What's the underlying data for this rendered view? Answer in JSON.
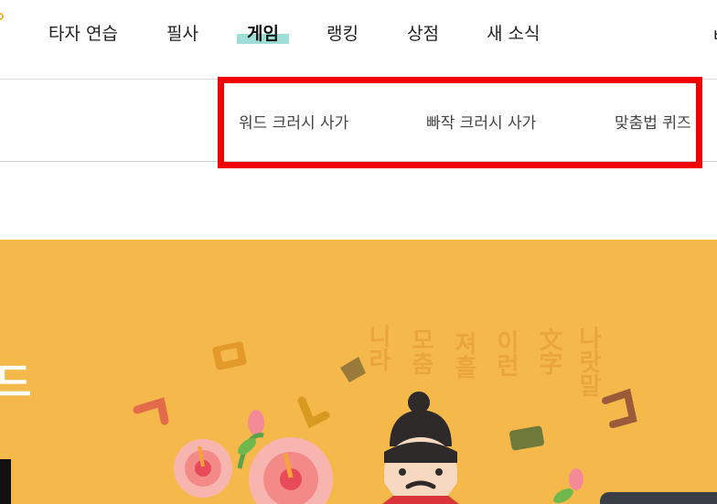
{
  "nav": {
    "items": [
      "타자 연습",
      "필사",
      "게임",
      "랭킹",
      "상점",
      "새 소식"
    ],
    "active_index": 2,
    "edge_glyph": "ㅂ"
  },
  "submenu": {
    "items": [
      "워드 크러시 사가",
      "빠작 크러시 사가",
      "맞춤법 퀴즈"
    ]
  },
  "banner": {
    "edge_text": "드",
    "bg_color": "#f5b94b",
    "hangul_columns": [
      "니라",
      "모춤",
      "져흘",
      "이런",
      "文字",
      "나랏말"
    ]
  },
  "colors": {
    "highlight_box": "#f20000",
    "active_underline": "#9fded6"
  }
}
